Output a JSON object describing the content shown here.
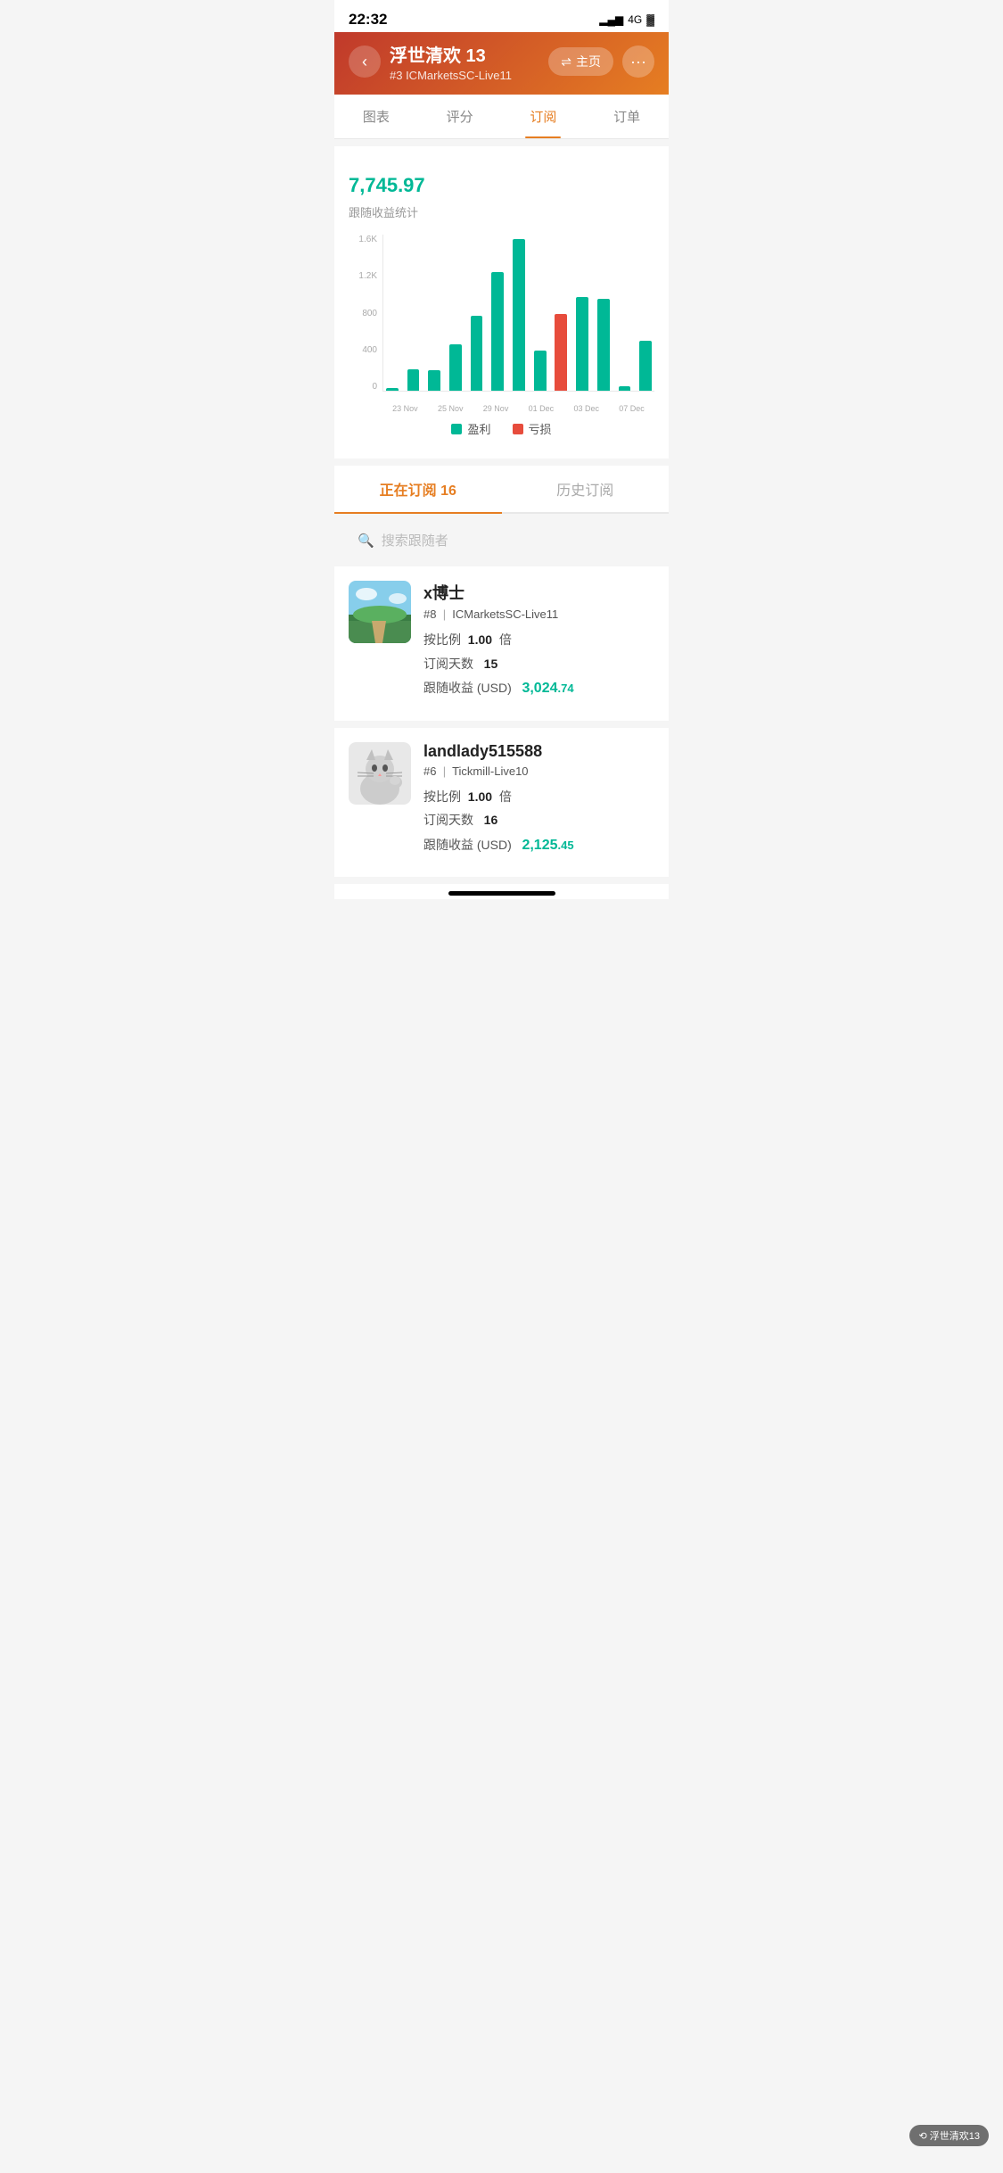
{
  "status": {
    "time": "22:32",
    "signal": "▂▄▆",
    "network": "4G",
    "battery": "🔋"
  },
  "header": {
    "title": "浮世清欢 13",
    "subtitle": "#3  ICMarketsSC-Live11",
    "home_label": "主页",
    "back_icon": "‹"
  },
  "tabs": [
    {
      "id": "chart",
      "label": "图表"
    },
    {
      "id": "rating",
      "label": "评分"
    },
    {
      "id": "subscribe",
      "label": "订阅",
      "active": true
    },
    {
      "id": "orders",
      "label": "订单"
    }
  ],
  "profit_summary": {
    "value": "7,745",
    "cents": ".97",
    "label": "跟随收益统计"
  },
  "chart": {
    "y_labels": [
      "1.6K",
      "1.2K",
      "800",
      "400",
      "0"
    ],
    "x_labels": [
      "23 Nov",
      "25 Nov",
      "29 Nov",
      "01 Dec",
      "03 Dec",
      "07 Dec"
    ],
    "bars": [
      {
        "value": 30,
        "type": "profit"
      },
      {
        "value": 220,
        "type": "profit"
      },
      {
        "value": 210,
        "type": "profit"
      },
      {
        "value": 480,
        "type": "profit"
      },
      {
        "value": 770,
        "type": "profit"
      },
      {
        "value": 1220,
        "type": "profit"
      },
      {
        "value": 1550,
        "type": "profit"
      },
      {
        "value": 420,
        "type": "profit"
      },
      {
        "value": 790,
        "type": "loss"
      },
      {
        "value": 960,
        "type": "profit"
      },
      {
        "value": 940,
        "type": "profit"
      },
      {
        "value": 55,
        "type": "profit"
      },
      {
        "value": 510,
        "type": "profit"
      }
    ],
    "legend": {
      "profit": "盈利",
      "loss": "亏损"
    }
  },
  "sub_tabs": {
    "active": "正在订阅",
    "active_count": "16",
    "history": "历史订阅"
  },
  "search": {
    "placeholder": "搜索跟随者"
  },
  "followers": [
    {
      "name": "x博士",
      "rank": "#8",
      "broker": "ICMarketsSC-Live11",
      "ratio": "1.00",
      "days": "15",
      "profit": "3,024",
      "cents": ".74",
      "avatar_type": "landscape"
    },
    {
      "name": "landlady515588",
      "rank": "#6",
      "broker": "Tickmill-Live10",
      "ratio": "1.00",
      "days": "16",
      "profit": "2,125",
      "cents": ".45",
      "avatar_type": "cat"
    }
  ],
  "labels": {
    "ratio_prefix": "按比例",
    "ratio_suffix": "倍",
    "days_label": "订阅天数",
    "profit_label": "跟随收益 (USD)"
  },
  "watermark": "浮世清欢13"
}
